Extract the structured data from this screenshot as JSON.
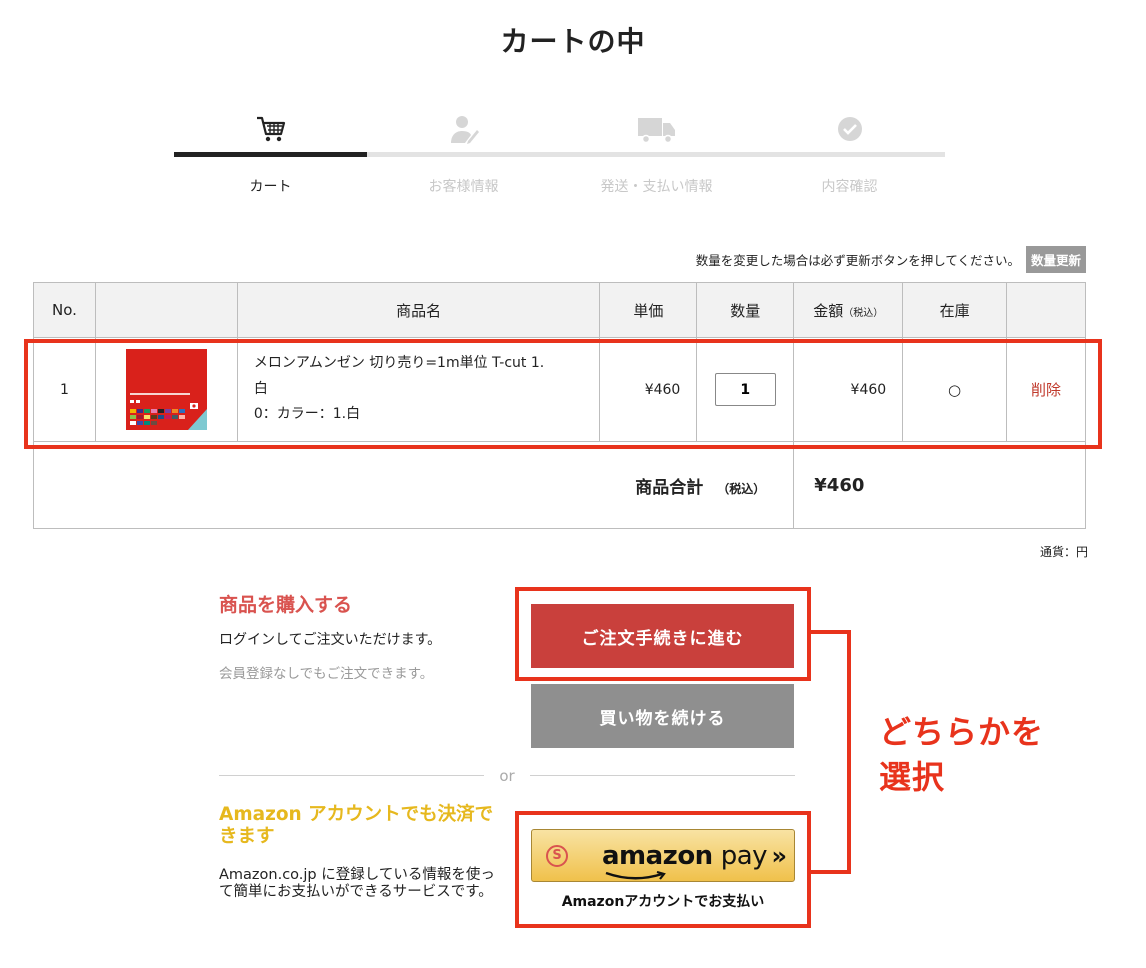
{
  "page": {
    "title": "カートの中"
  },
  "steps": [
    {
      "label": "カート",
      "icon": "cart-icon"
    },
    {
      "label": "お客様情報",
      "icon": "customer-info-icon"
    },
    {
      "label": "発送・支払い情報",
      "icon": "truck-icon"
    },
    {
      "label": "内容確認",
      "icon": "check-circle-icon"
    }
  ],
  "active_step": 0,
  "notice": {
    "text": "数量を変更した場合は必ず更新ボタンを押してください。",
    "update_label": "数量更新"
  },
  "table": {
    "headers": {
      "no": "No.",
      "name": "商品名",
      "unit_price": "単価",
      "quantity": "数量",
      "amount": "金額",
      "amount_note": "（税込）",
      "stock": "在庫"
    },
    "rows": [
      {
        "no": "1",
        "name_line1": "メロンアムンゼン 切り売り=1m単位 T-cut 1.",
        "name_line2": "白",
        "option": "0：カラー：1.白",
        "unit_price": "¥460",
        "quantity": "1",
        "amount": "¥460",
        "stock": "○",
        "delete_label": "削除"
      }
    ],
    "total": {
      "label": "商品合計",
      "note": "（税込）",
      "value": "¥460"
    }
  },
  "currency_note": "通貨：円",
  "purchase": {
    "title": "商品を購入する",
    "text": "ログインしてご注文いただけます。",
    "sub": "会員登録なしでもご注文できます。",
    "order_button": "ご注文手続きに進む",
    "continue_button": "買い物を続ける"
  },
  "or_label": "or",
  "amazon": {
    "title": "Amazon アカウントでも決済できます",
    "text": "Amazon.co.jp に登録している情報を使って簡単にお支払いができるサービスです。",
    "logo_main": "amazon",
    "logo_pay": "pay",
    "logo_arrow": "»",
    "caption": "Amazonアカウントでお支払い"
  },
  "annotation": {
    "text_line1": "どちらかを",
    "text_line2": "選択"
  },
  "colors": {
    "accent_red": "#c9403c",
    "annotation_red": "#e8331c",
    "amazon_gold": "#e6b81e",
    "gray_button": "#8f8f8f"
  }
}
